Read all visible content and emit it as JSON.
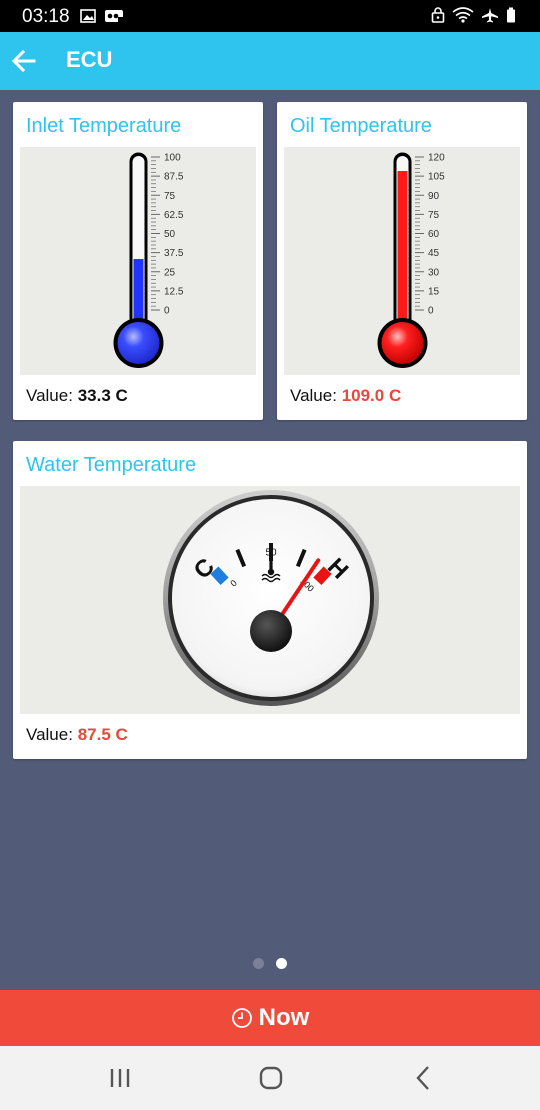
{
  "status_bar": {
    "time": "03:18"
  },
  "app_bar": {
    "title": "ECU"
  },
  "cards": {
    "inlet": {
      "title": "Inlet Temperature",
      "value_label": "Value:",
      "value": "33.3 C",
      "value_color": "#111111",
      "fill_color": "#1f35ff",
      "scale_labels": [
        "100",
        "87.5",
        "75",
        "62.5",
        "50",
        "37.5",
        "25",
        "12.5",
        "0"
      ],
      "scale_min": 0,
      "scale_max": 100,
      "reading": 33.3
    },
    "oil": {
      "title": "Oil Temperature",
      "value_label": "Value:",
      "value": "109.0 C",
      "value_color": "#e8483a",
      "fill_color": "#ff1a1a",
      "scale_labels": [
        "120",
        "105",
        "90",
        "75",
        "60",
        "45",
        "30",
        "15",
        "0"
      ],
      "scale_min": 0,
      "scale_max": 120,
      "reading": 109.0
    },
    "water": {
      "title": "Water Temperature",
      "value_label": "Value:",
      "value": "87.5 C",
      "value_color": "#e8483a",
      "gauge_labels": {
        "cold": "C",
        "hot": "H",
        "min": "0",
        "mid": "50",
        "max": "100"
      },
      "gauge_min": 0,
      "gauge_max": 100,
      "reading": 87.5
    }
  },
  "pager": {
    "count": 2,
    "active_index": 1
  },
  "bottom_action": {
    "label": "Now"
  },
  "colors": {
    "accent": "#2ec4ee",
    "background": "#525c78",
    "action": "#f04b3a"
  }
}
